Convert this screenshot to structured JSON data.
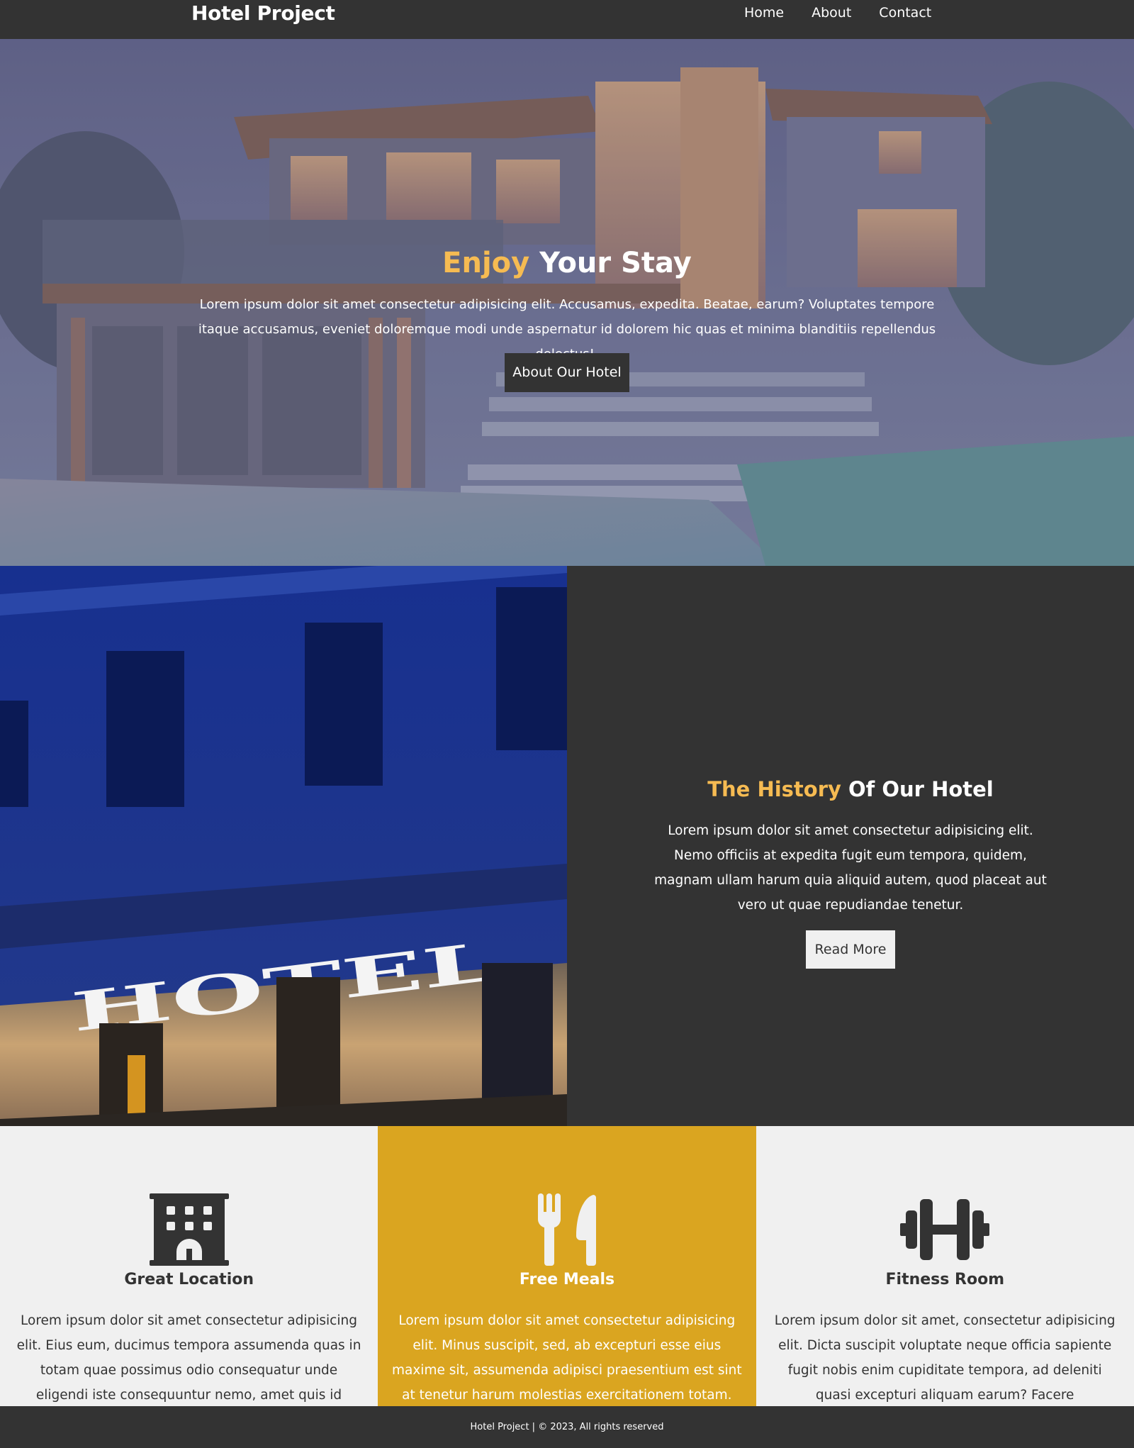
{
  "nav": {
    "brand": "Hotel Project",
    "links": [
      "Home",
      "About",
      "Contact"
    ]
  },
  "hero": {
    "title_accent": "Enjoy",
    "title_rest": " Your Stay",
    "text": "Lorem ipsum dolor sit amet consectetur adipisicing elit. Accusamus, expedita. Beatae, earum? Voluptates tempore itaque accusamus, eveniet doloremque modi unde aspernatur id dolorem hic quas et minima blanditiis repellendus delectus!.",
    "button": "About Our Hotel"
  },
  "history": {
    "sign_text": "HOTEL",
    "title_accent": "The History",
    "title_rest": " Of Our Hotel",
    "text": "Lorem ipsum dolor sit amet consectetur adipisicing elit. Nemo officiis at expedita fugit eum tempora, quidem, magnam ullam harum quia aliquid autem, quod placeat aut vero ut quae repudiandae tenetur.",
    "button": "Read More"
  },
  "features": [
    {
      "icon": "hotel-building-icon",
      "title": "Great Location",
      "text": "Lorem ipsum dolor sit amet consectetur adipisicing elit. Eius eum, ducimus tempora assumenda quas in totam quae possimus odio consequatur unde eligendi iste consequuntur nemo, amet quis id voluptas beatae?"
    },
    {
      "icon": "fork-knife-icon",
      "title": "Free Meals",
      "text": "Lorem ipsum dolor sit amet consectetur adipisicing elit. Minus suscipit, sed, ab excepturi esse eius maxime sit, assumenda adipisci praesentium est sint at tenetur harum molestias exercitationem totam. Ipsam, at."
    },
    {
      "icon": "dumbbell-icon",
      "title": "Fitness Room",
      "text": "Lorem ipsum dolor sit amet, consectetur adipisicing elit. Dicta suscipit voluptate neque officia sapiente fugit nobis enim cupiditate tempora, ad deleniti quasi excepturi aliquam earum? Facere necessitatibus harum"
    }
  ],
  "footer": {
    "text": "Hotel Project | © 2023, All rights reserved"
  },
  "colors": {
    "dark": "#333333",
    "accent": "#f6bb52",
    "gold": "#daa520",
    "light": "#f0f0f0"
  }
}
